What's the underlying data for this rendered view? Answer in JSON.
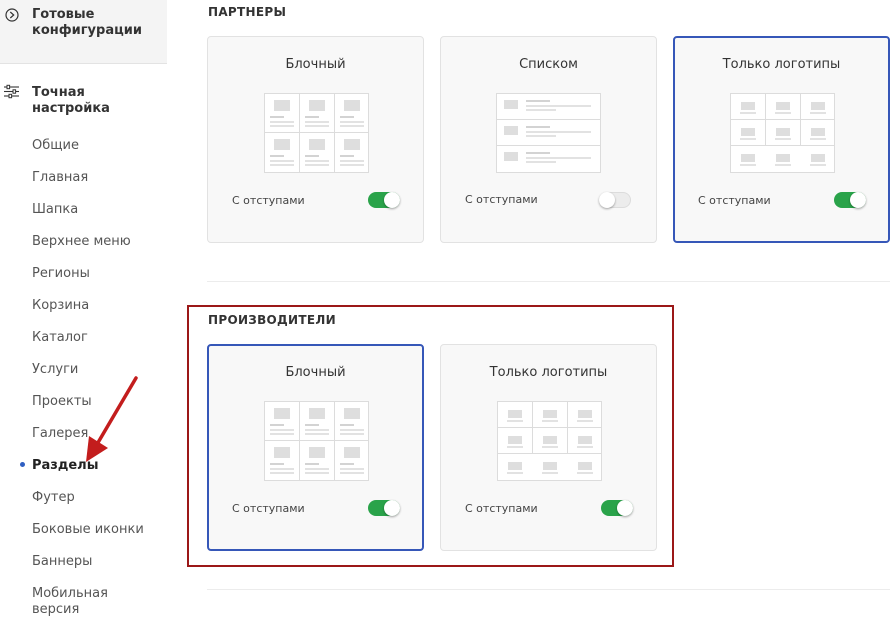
{
  "sidebar": {
    "ready_label": "Готовые конфигурации",
    "precise_label": "Точная настройка",
    "items": [
      {
        "label": "Общие"
      },
      {
        "label": "Главная"
      },
      {
        "label": "Шапка"
      },
      {
        "label": "Верхнее меню"
      },
      {
        "label": "Регионы"
      },
      {
        "label": "Корзина"
      },
      {
        "label": "Каталог"
      },
      {
        "label": "Услуги"
      },
      {
        "label": "Проекты"
      },
      {
        "label": "Галерея"
      },
      {
        "label": "Разделы",
        "active": true
      },
      {
        "label": "Футер"
      },
      {
        "label": "Боковые иконки"
      },
      {
        "label": "Баннеры"
      },
      {
        "label": "Мобильная версия"
      }
    ]
  },
  "partners": {
    "title": "ПАРТНЕРЫ",
    "cards": [
      {
        "title": "Блочный",
        "toggle_label": "С отступами",
        "toggle_on": true,
        "selected": false,
        "thumb": "block-icon"
      },
      {
        "title": "Списком",
        "toggle_label": "С отступами",
        "toggle_on": false,
        "selected": false,
        "thumb": "list-icon"
      },
      {
        "title": "Только логотипы",
        "toggle_label": "С отступами",
        "toggle_on": true,
        "selected": true,
        "thumb": "logos-icon"
      }
    ]
  },
  "manufacturers": {
    "title": "ПРОИЗВОДИТЕЛИ",
    "cards": [
      {
        "title": "Блочный",
        "toggle_label": "С отступами",
        "toggle_on": true,
        "selected": true,
        "thumb": "block-icon"
      },
      {
        "title": "Только логотипы",
        "toggle_label": "С отступами",
        "toggle_on": true,
        "selected": false,
        "thumb": "logos-icon"
      }
    ]
  },
  "colors": {
    "accent_blue": "#3657b8",
    "toggle_green": "#2aa34a",
    "annotation_red": "#9b1818",
    "arrow_red": "#c31d1d"
  }
}
